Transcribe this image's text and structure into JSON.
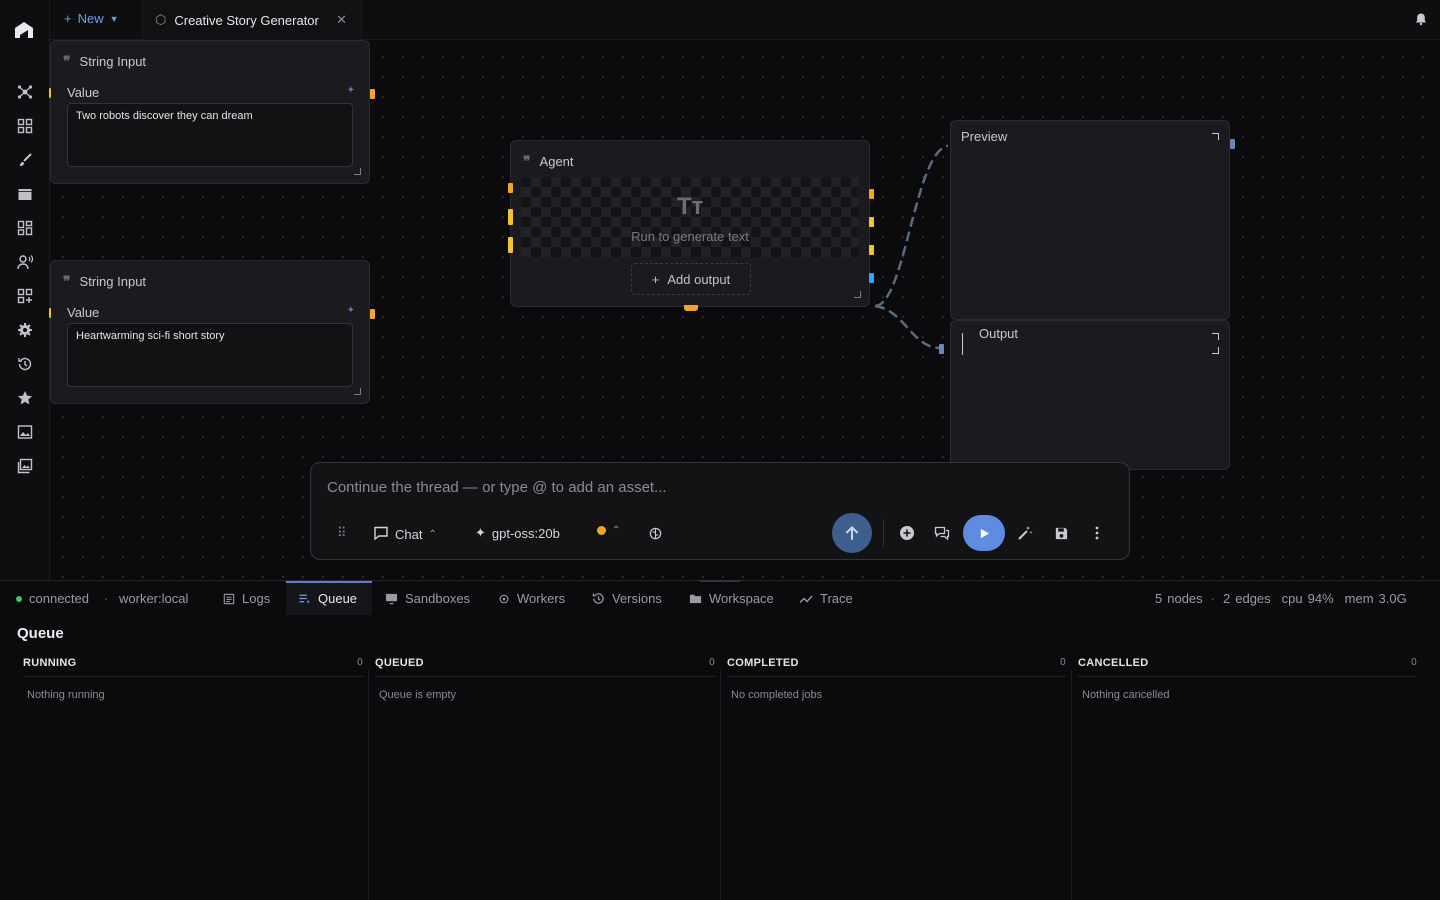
{
  "topbar": {
    "new_label": "New",
    "tab_title": "Creative Story Generator"
  },
  "nodes": {
    "string_input_1": {
      "title": "String Input",
      "value_label": "Value",
      "value": "Two robots discover they can dream"
    },
    "string_input_2": {
      "title": "String Input",
      "value_label": "Value",
      "value": "Heartwarming sci-fi short story"
    },
    "agent": {
      "title": "Agent",
      "placeholder": "Run to generate text",
      "add_output_label": "Add output"
    },
    "preview": {
      "title": "Preview"
    },
    "output": {
      "title": "Output"
    }
  },
  "composer": {
    "placeholder": "Continue the thread — or type @ to add an asset...",
    "mode_label": "Chat",
    "model_label": "gpt-oss:20b"
  },
  "statusbar": {
    "connection": "connected",
    "worker": "worker:local",
    "tabs": [
      "Logs",
      "Queue",
      "Sandboxes",
      "Workers",
      "Versions",
      "Workspace",
      "Trace"
    ],
    "active_tab": "Queue",
    "nodes_count": "5",
    "nodes_label": "nodes",
    "edges_count": "2",
    "edges_label": "edges",
    "cpu_label": "cpu",
    "cpu_value": "94%",
    "mem_label": "mem",
    "mem_value": "3.0G"
  },
  "queue": {
    "title": "Queue",
    "columns": [
      {
        "name": "RUNNING",
        "count": "0",
        "empty": "Nothing running"
      },
      {
        "name": "QUEUED",
        "count": "0",
        "empty": "Queue is empty"
      },
      {
        "name": "COMPLETED",
        "count": "0",
        "empty": "No completed jobs"
      },
      {
        "name": "CANCELLED",
        "count": "0",
        "empty": "Nothing cancelled"
      }
    ]
  },
  "colors": {
    "accent": "#5f8be0",
    "port_orange": "#f5a524",
    "port_yellow": "#f2c230",
    "port_blue": "#2aa8ff",
    "connected": "#3fc56b"
  }
}
